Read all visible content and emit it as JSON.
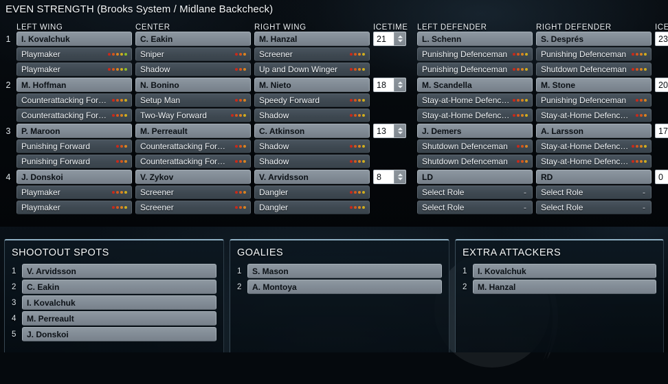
{
  "header": {
    "title": "EVEN STRENGTH (Brooks System / Midlane Backcheck)"
  },
  "columns": {
    "left_wing": "LEFT WING",
    "center": "CENTER",
    "right_wing": "RIGHT WING",
    "icetime_fwd": "ICETIME",
    "left_defender": "LEFT DEFENDER",
    "right_defender": "RIGHT DEFENDER",
    "icetime_def": "ICETIME"
  },
  "rating_colors": [
    "#c8291b",
    "#d4561c",
    "#d98420",
    "#cfad1f",
    "#8fbf27"
  ],
  "forward_lines": [
    {
      "number": "1",
      "icetime": "21",
      "left_wing": {
        "player": "I. Kovalchuk",
        "roles": [
          {
            "name": "Playmaker",
            "rating": 5
          },
          {
            "name": "Playmaker",
            "rating": 5
          }
        ]
      },
      "center": {
        "player": "C. Eakin",
        "roles": [
          {
            "name": "Sniper",
            "rating": 3
          },
          {
            "name": "Shadow",
            "rating": 3
          }
        ]
      },
      "right_wing": {
        "player": "M. Hanzal",
        "roles": [
          {
            "name": "Screener",
            "rating": 4
          },
          {
            "name": "Up and Down Winger",
            "rating": 4
          }
        ]
      }
    },
    {
      "number": "2",
      "icetime": "18",
      "left_wing": {
        "player": "M. Hoffman",
        "roles": [
          {
            "name": "Counterattacking For…",
            "rating": 4
          },
          {
            "name": "Counterattacking For…",
            "rating": 4
          }
        ]
      },
      "center": {
        "player": "N. Bonino",
        "roles": [
          {
            "name": "Setup Man",
            "rating": 3
          },
          {
            "name": "Two-Way Forward",
            "rating": 4
          }
        ]
      },
      "right_wing": {
        "player": "M. Nieto",
        "roles": [
          {
            "name": "Speedy Forward",
            "rating": 4
          },
          {
            "name": "Shadow",
            "rating": 4
          }
        ]
      }
    },
    {
      "number": "3",
      "icetime": "13",
      "left_wing": {
        "player": "P. Maroon",
        "roles": [
          {
            "name": "Punishing Forward",
            "rating": 3
          },
          {
            "name": "Punishing Forward",
            "rating": 3
          }
        ]
      },
      "center": {
        "player": "M. Perreault",
        "roles": [
          {
            "name": "Counterattacking For…",
            "rating": 3
          },
          {
            "name": "Counterattacking For…",
            "rating": 3
          }
        ]
      },
      "right_wing": {
        "player": "C. Atkinson",
        "roles": [
          {
            "name": "Shadow",
            "rating": 4
          },
          {
            "name": "Shadow",
            "rating": 4
          }
        ]
      }
    },
    {
      "number": "4",
      "icetime": "8",
      "left_wing": {
        "player": "J. Donskoi",
        "roles": [
          {
            "name": "Playmaker",
            "rating": 4
          },
          {
            "name": "Playmaker",
            "rating": 4
          }
        ]
      },
      "center": {
        "player": "V. Zykov",
        "roles": [
          {
            "name": "Screener",
            "rating": 3
          },
          {
            "name": "Screener",
            "rating": 3
          }
        ]
      },
      "right_wing": {
        "player": "V. Arvidsson",
        "roles": [
          {
            "name": "Dangler",
            "rating": 4
          },
          {
            "name": "Dangler",
            "rating": 4
          }
        ]
      }
    }
  ],
  "defense_pairs": [
    {
      "icetime": "23",
      "left_defender": {
        "player": "L. Schenn",
        "roles": [
          {
            "name": "Punishing Defenceman",
            "rating": 4
          },
          {
            "name": "Punishing Defenceman",
            "rating": 4
          }
        ]
      },
      "right_defender": {
        "player": "S. Després",
        "roles": [
          {
            "name": "Punishing Defenceman",
            "rating": 4
          },
          {
            "name": "Shutdown Defenceman",
            "rating": 4
          }
        ]
      }
    },
    {
      "icetime": "20",
      "left_defender": {
        "player": "M. Scandella",
        "roles": [
          {
            "name": "Stay-at-Home Defenc…",
            "rating": 4
          },
          {
            "name": "Stay-at-Home Defenc…",
            "rating": 4
          }
        ]
      },
      "right_defender": {
        "player": "M. Stone",
        "roles": [
          {
            "name": "Punishing Defenceman",
            "rating": 3
          },
          {
            "name": "Stay-at-Home Defenc…",
            "rating": 3
          }
        ]
      }
    },
    {
      "icetime": "17",
      "left_defender": {
        "player": "J. Demers",
        "roles": [
          {
            "name": "Shutdown Defenceman",
            "rating": 3
          },
          {
            "name": "Shutdown Defenceman",
            "rating": 3
          }
        ]
      },
      "right_defender": {
        "player": "A. Larsson",
        "roles": [
          {
            "name": "Stay-at-Home Defenc…",
            "rating": 4
          },
          {
            "name": "Stay-at-Home Defenc…",
            "rating": 4
          }
        ]
      }
    },
    {
      "icetime": "0",
      "left_defender": {
        "player": "LD",
        "roles": [
          {
            "name": "Select Role",
            "rating": 0
          },
          {
            "name": "Select Role",
            "rating": 0
          }
        ]
      },
      "right_defender": {
        "player": "RD",
        "roles": [
          {
            "name": "Select Role",
            "rating": 0
          },
          {
            "name": "Select Role",
            "rating": 0
          }
        ]
      }
    }
  ],
  "shootout": {
    "title": "SHOOTOUT SPOTS",
    "items": [
      {
        "num": "1",
        "player": "V. Arvidsson"
      },
      {
        "num": "2",
        "player": "C. Eakin"
      },
      {
        "num": "3",
        "player": "I. Kovalchuk"
      },
      {
        "num": "4",
        "player": "M. Perreault"
      },
      {
        "num": "5",
        "player": "J. Donskoi"
      }
    ]
  },
  "goalies": {
    "title": "GOALIES",
    "items": [
      {
        "num": "1",
        "player": "S. Mason"
      },
      {
        "num": "2",
        "player": "A. Montoya"
      }
    ]
  },
  "extra_attackers": {
    "title": "EXTRA ATTACKERS",
    "items": [
      {
        "num": "1",
        "player": "I. Kovalchuk"
      },
      {
        "num": "2",
        "player": "M. Hanzal"
      }
    ]
  }
}
